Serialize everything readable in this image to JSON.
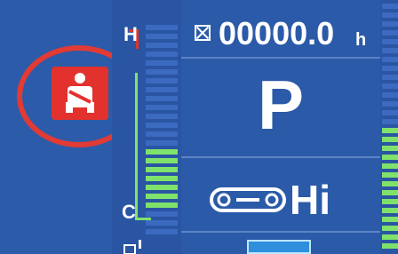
{
  "status": {
    "hour_meter": "00000.0",
    "hour_unit": "h",
    "gear": "P",
    "travel_speed": "Hi"
  },
  "gauge": {
    "high_label": "H",
    "low_label": "C"
  },
  "icons": {
    "seatbelt": "seatbelt-warning-icon",
    "hourglass": "hour-meter-icon",
    "crawler": "crawler-track-icon"
  },
  "colors": {
    "background": "#2b5aa8",
    "warning": "#e3312e",
    "gauge_lit": "#7ee26b",
    "highlight_ring": "#e23a35"
  }
}
